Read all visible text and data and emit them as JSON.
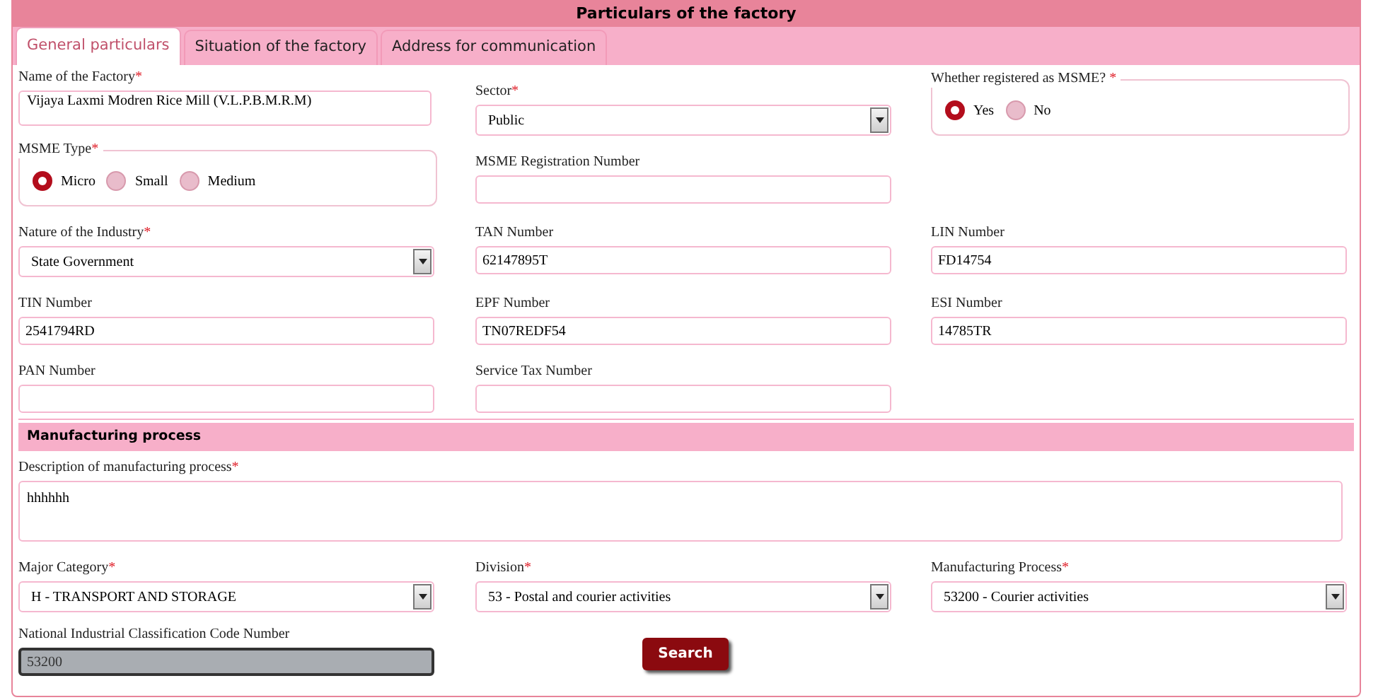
{
  "title": "Particulars of the factory",
  "tabs": [
    {
      "label": "General particulars",
      "selected": true
    },
    {
      "label": "Situation of the factory",
      "selected": false
    },
    {
      "label": "Address for communication",
      "selected": false
    }
  ],
  "rows": [
    [
      {
        "kind": "textarea",
        "label": "Name of the Factory",
        "mark": "*",
        "value": "Vijaya Laxmi Modren Rice Mill (V.L.P.B.M.R.M)"
      },
      {
        "kind": "select",
        "label": "Sector",
        "mark": "*",
        "value": "Public"
      },
      {
        "kind": "radio",
        "label": "Whether registered as MSME? ",
        "mark": "*",
        "options": [
          {
            "label": "Yes",
            "selected": true
          },
          {
            "label": "No",
            "selected": false
          }
        ]
      }
    ],
    [
      {
        "kind": "radio",
        "label": "MSME Type",
        "mark": "*",
        "options": [
          {
            "label": "Micro",
            "selected": true
          },
          {
            "label": "Small",
            "selected": false
          },
          {
            "label": "Medium",
            "selected": false
          }
        ]
      },
      {
        "kind": "text",
        "label": "MSME Registration Number"
      }
    ],
    [
      {
        "kind": "select",
        "label": "Nature of the Industry",
        "mark": "*",
        "value": "State Government"
      },
      {
        "kind": "text",
        "label": "TAN Number",
        "value": "62147895T"
      },
      {
        "kind": "text",
        "label": "LIN Number",
        "value": "FD14754"
      }
    ],
    [
      {
        "kind": "text",
        "label": "TIN Number",
        "value": "2541794RD"
      },
      {
        "kind": "text",
        "label": "EPF Number",
        "value": "TN07REDF54"
      },
      {
        "kind": "text",
        "label": "ESI Number",
        "value": "14785TR"
      }
    ],
    [
      {
        "kind": "text",
        "label": "PAN Number"
      },
      {
        "kind": "text",
        "label": "Service Tax Number"
      }
    ]
  ],
  "section": "Manufacturing process",
  "description": {
    "label": "Description of manufacturing process",
    "mark": "*",
    "value": "hhhhhh"
  },
  "selects": [
    {
      "label": "Major Category",
      "mark": "*",
      "value": "H - TRANSPORT AND STORAGE"
    },
    {
      "label": "Division",
      "mark": "*",
      "value": "53 - Postal and courier activities"
    },
    {
      "label": "Manufacturing Process",
      "mark": "*",
      "value": "53200 - Courier activities"
    }
  ],
  "nic": {
    "label": "National Industrial Classification Code Number",
    "value": "53200",
    "disabled": true
  },
  "search_button": "Search"
}
